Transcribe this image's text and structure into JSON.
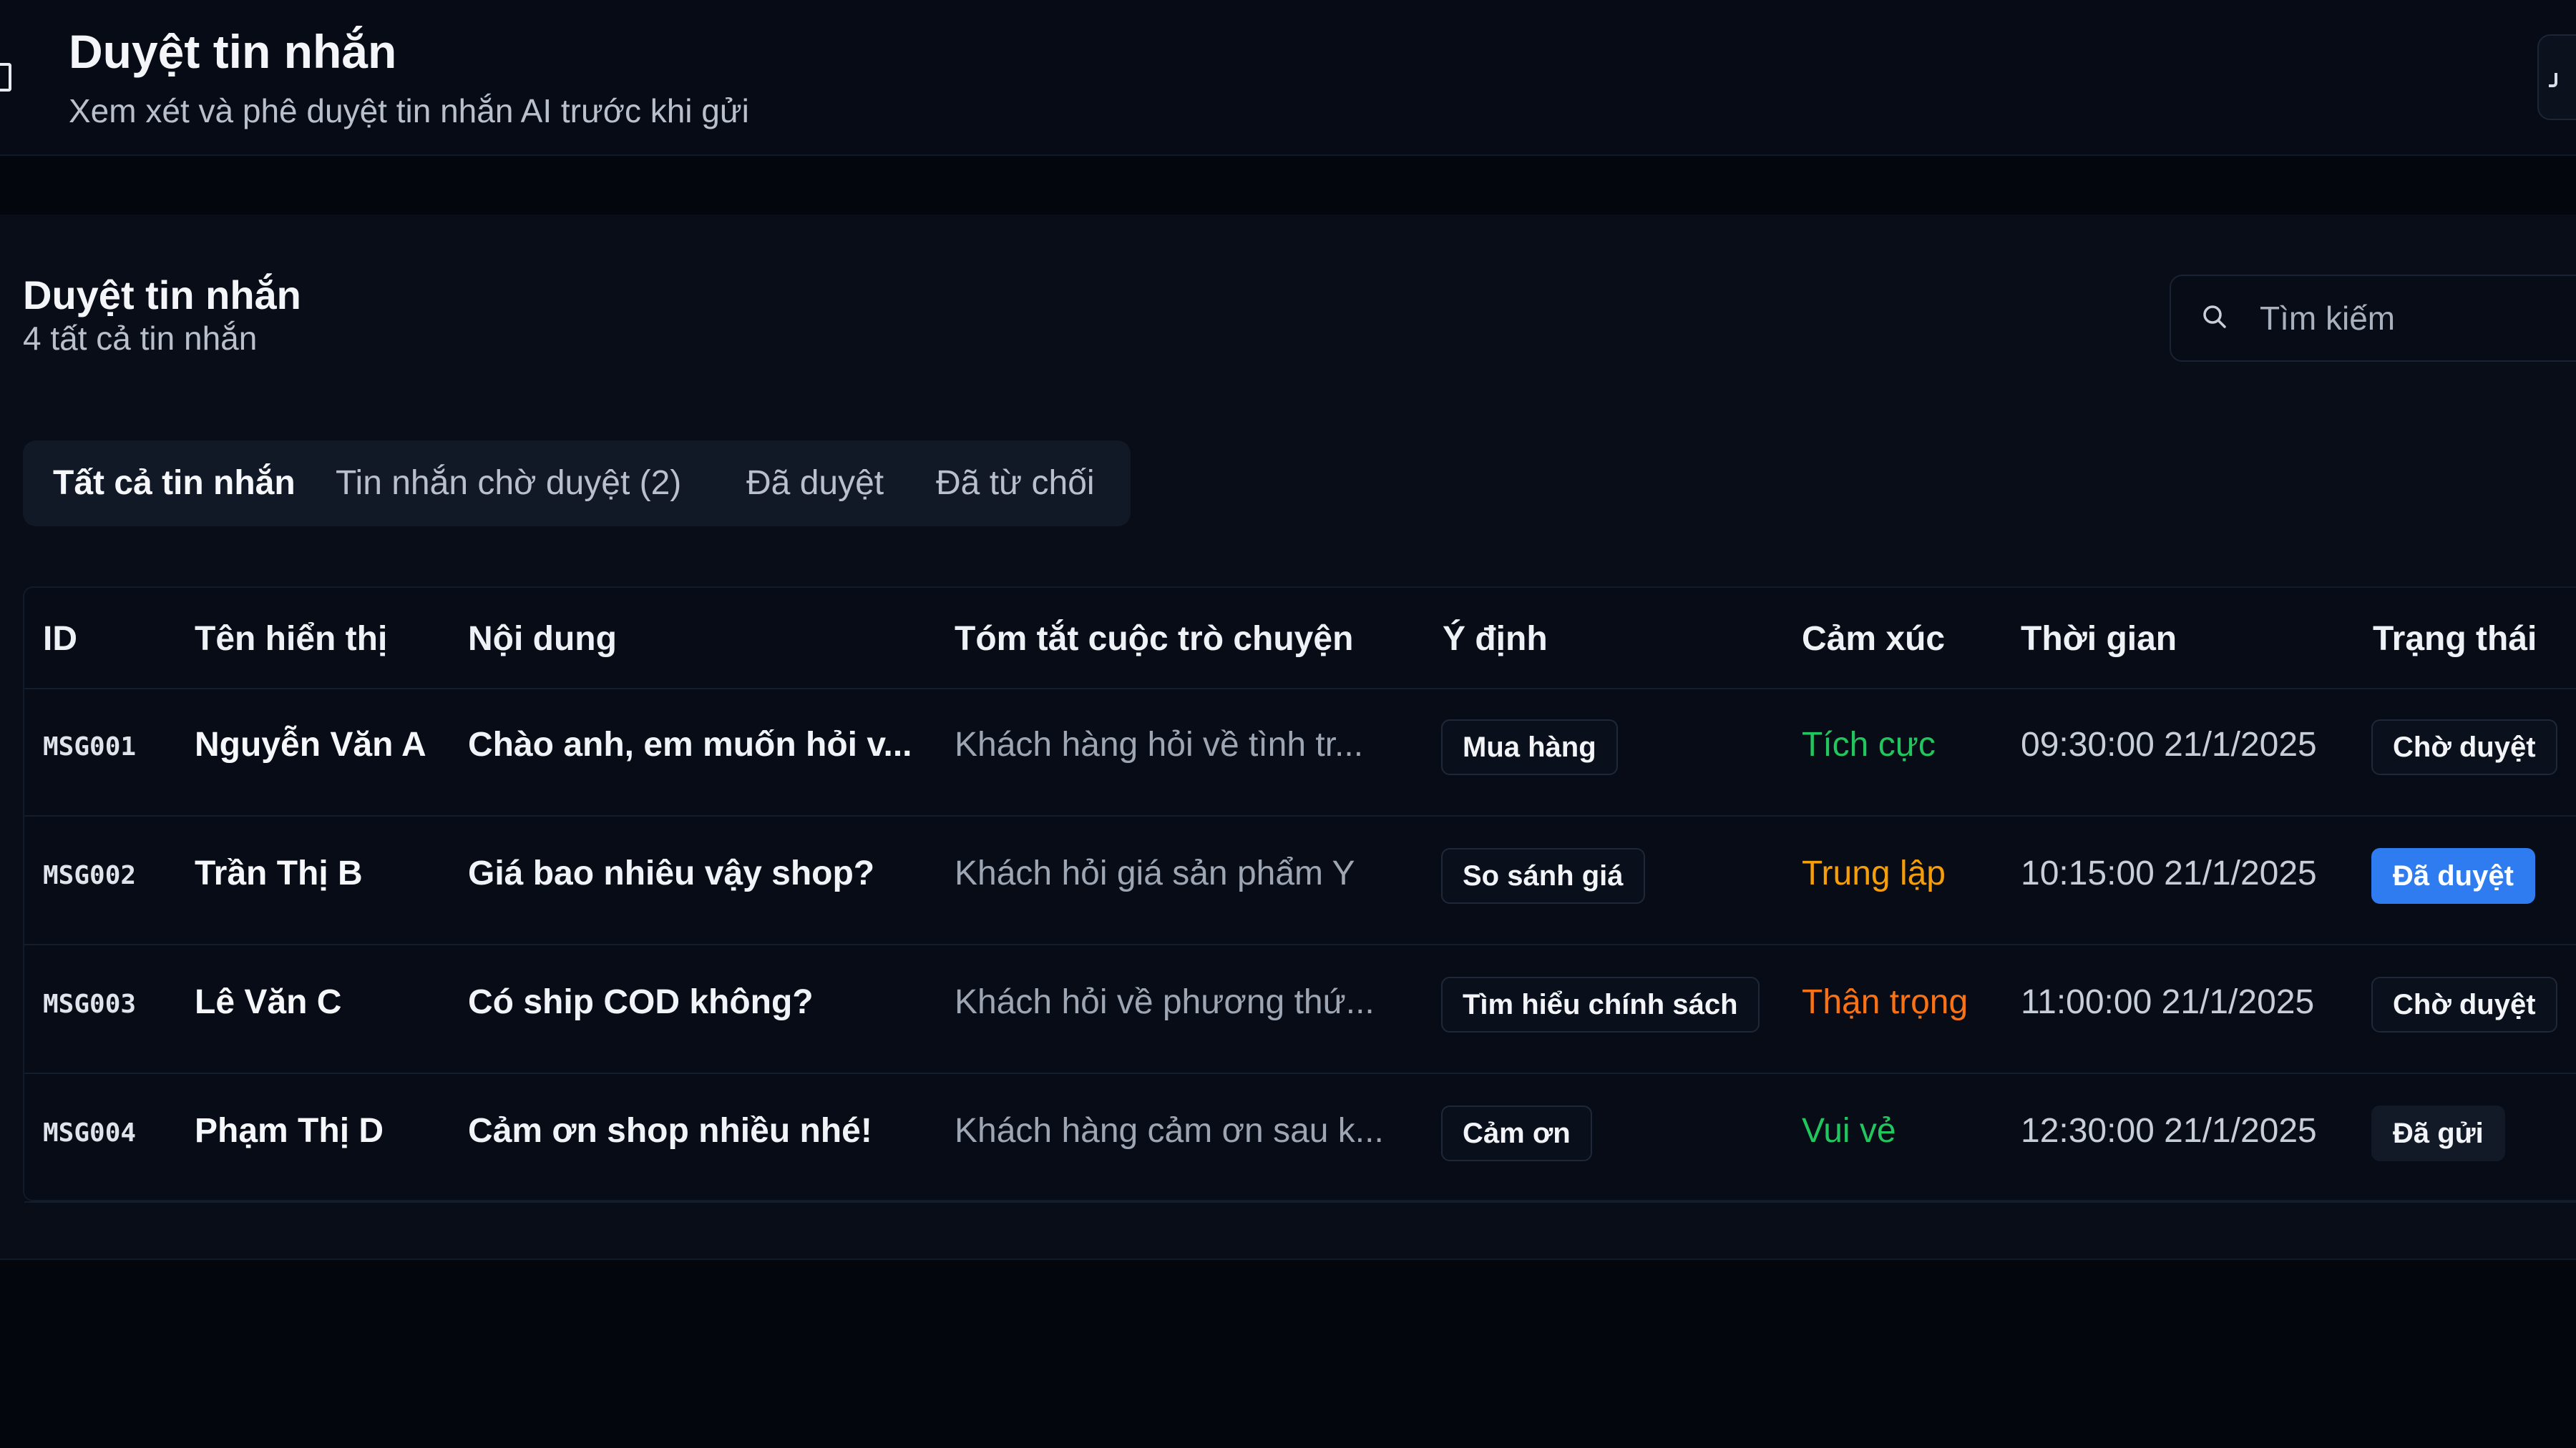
{
  "header": {
    "title": "Duyệt tin nhắn",
    "subtitle": "Xem xét và phê duyệt tin nhắn AI trước khi gửi"
  },
  "panel": {
    "title": "Duyệt tin nhắn",
    "count_label": "4 tất cả tin nhắn"
  },
  "search": {
    "placeholder": "Tìm kiếm",
    "icon": "search-icon"
  },
  "tabs": [
    {
      "label": "Tất cả tin nhắn",
      "active": true
    },
    {
      "label": "Tin nhắn chờ duyệt (2)",
      "active": false
    },
    {
      "label": "Đã duyệt",
      "active": false
    },
    {
      "label": "Đã từ chối",
      "active": false
    }
  ],
  "table": {
    "columns": [
      "ID",
      "Tên hiển thị",
      "Nội dung",
      "Tóm tắt cuộc trò chuyện",
      "Ý định",
      "Cảm xúc",
      "Thời gian",
      "Trạng thái"
    ],
    "rows": [
      {
        "id": "MSG001",
        "name": "Nguyễn Văn A",
        "content": "Chào anh, em muốn hỏi v...",
        "summary": "Khách hàng hỏi về tình tr...",
        "intent": "Mua hàng",
        "sentiment": "Tích cực",
        "sentiment_color": "#22c55e",
        "time": "09:30:00 21/1/2025",
        "status": "Chờ duyệt"
      },
      {
        "id": "MSG002",
        "name": "Trần Thị B",
        "content": "Giá bao nhiêu vậy shop?",
        "summary": "Khách hỏi giá sản phẩm Y",
        "intent": "So sánh giá",
        "sentiment": "Trung lập",
        "sentiment_color": "#f59e0b",
        "time": "10:15:00 21/1/2025",
        "status": "Đã duyệt"
      },
      {
        "id": "MSG003",
        "name": "Lê Văn C",
        "content": "Có ship COD không?",
        "summary": "Khách hỏi về phương thứ...",
        "intent": "Tìm hiểu chính sách",
        "sentiment": "Thận trọng",
        "sentiment_color": "#f97316",
        "time": "11:00:00 21/1/2025",
        "status": "Chờ duyệt"
      },
      {
        "id": "MSG004",
        "name": "Phạm Thị D",
        "content": "Cảm ơn shop nhiều nhé!",
        "summary": "Khách hàng cảm ơn sau k...",
        "intent": "Cảm ơn",
        "sentiment": "Vui vẻ",
        "sentiment_color": "#22c55e",
        "time": "12:30:00 21/1/2025",
        "status": "Đã gửi"
      }
    ]
  },
  "colors": {
    "background": "#03060c",
    "panel": "#080d17",
    "approved_badge": "#2f7cf0"
  }
}
